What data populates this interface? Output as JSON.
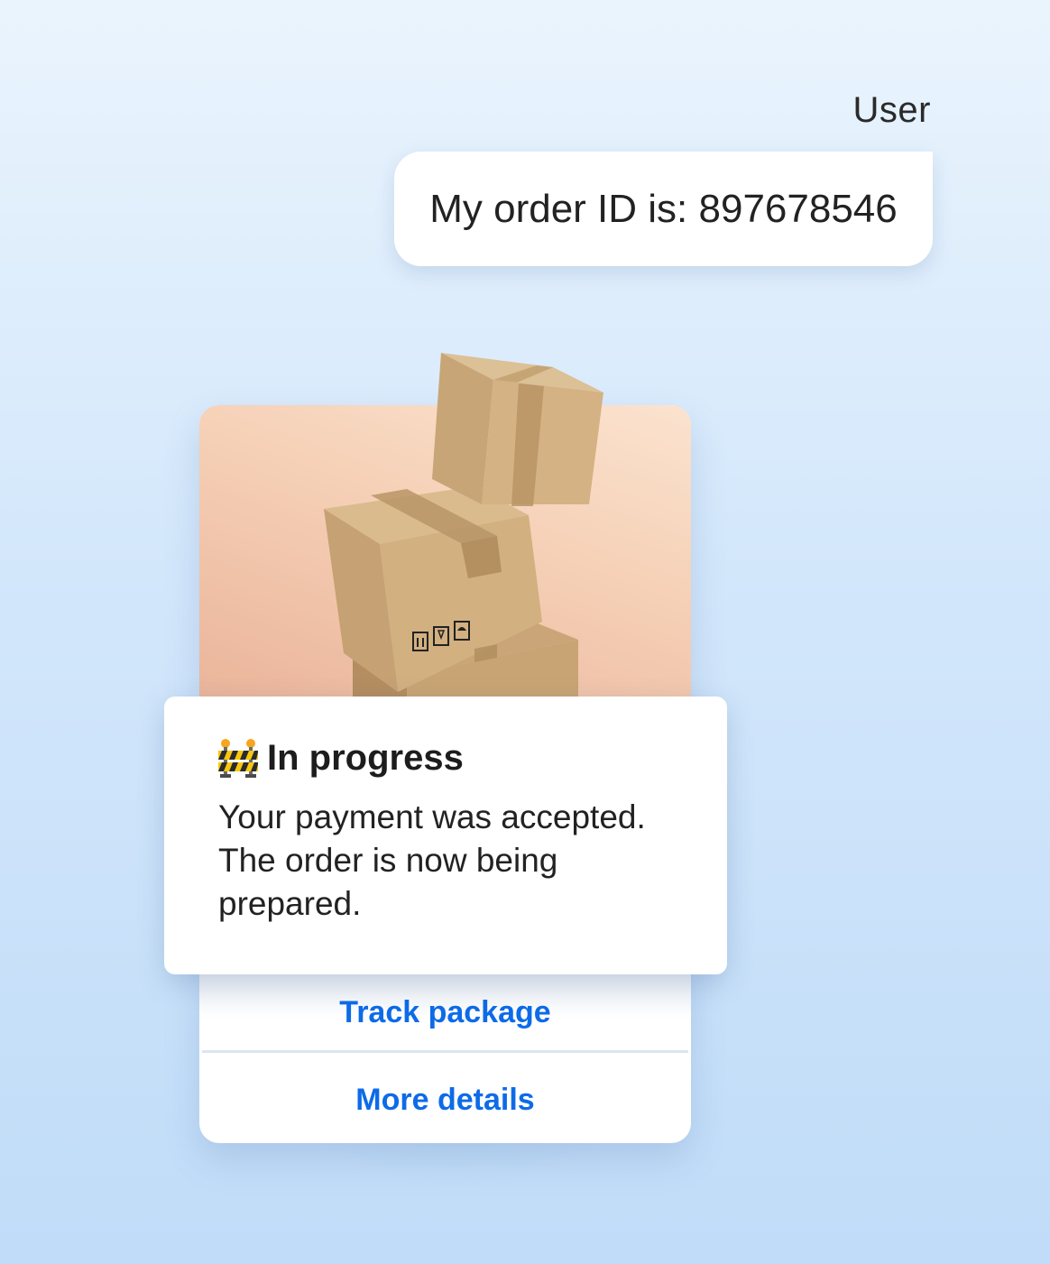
{
  "chat": {
    "sender": "User",
    "user_message": "My order ID is: 897678546"
  },
  "order_card": {
    "image": "stacked-cardboard-boxes",
    "status_icon": "construction-barrier-icon",
    "status_title": "In progress",
    "status_line_1": "Your payment was accepted.",
    "status_line_2": "The order is now being",
    "status_line_3": "prepared.",
    "actions": {
      "track_label": "Track package",
      "details_label": "More details"
    }
  },
  "colors": {
    "link": "#0d6be8",
    "image_bg": "#f5cfb5",
    "page_bg": "#d3e7fb"
  }
}
